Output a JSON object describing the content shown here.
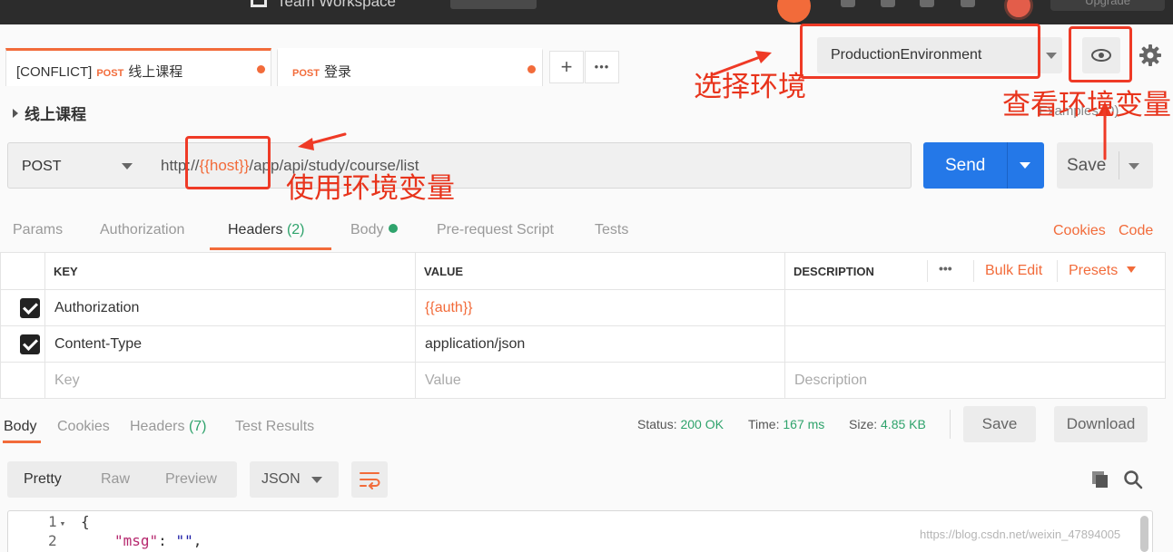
{
  "topbar": {
    "workspace_title": "Team Workspace",
    "upgrade_label": "Upgrade"
  },
  "tabs": [
    {
      "prefix": "[CONFLICT]",
      "method": "POST",
      "name": "线上课程"
    },
    {
      "prefix": "",
      "method": "POST",
      "name": "登录"
    }
  ],
  "tab_actions": {
    "add": "+",
    "more": "•••"
  },
  "environment": {
    "selected": "ProductionEnvironment"
  },
  "breadcrumb": {
    "name": "线上课程"
  },
  "examples_label": "Examples (0)",
  "request": {
    "method": "POST",
    "url_prefix": "http://",
    "url_variable": "{{host}}",
    "url_suffix": "/app/api/study/course/list",
    "send_label": "Send",
    "save_label": "Save"
  },
  "request_tabs": {
    "params": "Params",
    "authorization": "Authorization",
    "headers": "Headers",
    "headers_count": "(2)",
    "body": "Body",
    "pre_request": "Pre-request Script",
    "tests": "Tests",
    "cookies": "Cookies",
    "code": "Code"
  },
  "headers_table": {
    "columns": {
      "key": "KEY",
      "value": "VALUE",
      "description": "DESCRIPTION"
    },
    "more": "•••",
    "bulk_edit": "Bulk Edit",
    "presets": "Presets",
    "rows": [
      {
        "key": "Authorization",
        "value": "{{auth}}"
      },
      {
        "key": "Content-Type",
        "value": "application/json"
      }
    ],
    "placeholders": {
      "key": "Key",
      "value": "Value",
      "description": "Description"
    }
  },
  "response": {
    "tabs": {
      "body": "Body",
      "cookies": "Cookies",
      "headers": "Headers",
      "headers_count": "(7)",
      "test_results": "Test Results"
    },
    "status_label": "Status:",
    "status_value": "200 OK",
    "time_label": "Time:",
    "time_value": "167 ms",
    "size_label": "Size:",
    "size_value": "4.85 KB",
    "save_label": "Save",
    "download_label": "Download",
    "formats": {
      "pretty": "Pretty",
      "raw": "Raw",
      "preview": "Preview"
    },
    "language": "JSON",
    "code_lines": [
      {
        "num": "1",
        "fold": "▾",
        "text": "{"
      },
      {
        "num": "2",
        "fold": "",
        "key": "\"msg\"",
        "colon": ": ",
        "val": "\"\"",
        "tail": ","
      }
    ]
  },
  "annotations": {
    "select_env": "选择环境",
    "view_env": "查看环境变量",
    "use_env": "使用环境变量"
  },
  "watermark": "https://blog.csdn.net/weixin_47894005",
  "colors": {
    "accent": "#f26b3a",
    "send_blue": "#2478e8",
    "success": "#2fa36c",
    "annotation_red": "#e8341c"
  }
}
